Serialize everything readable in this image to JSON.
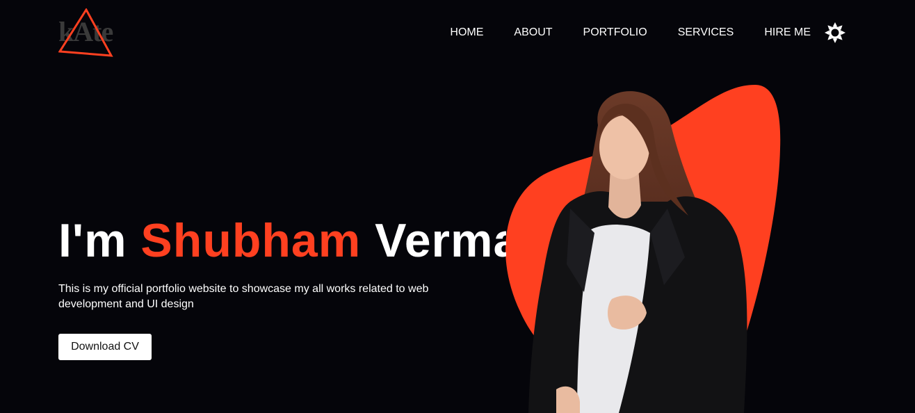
{
  "brand": {
    "logo_text": "kAte",
    "logo_color": "#3a3a3a",
    "accent": "#ff4020"
  },
  "nav": {
    "items": [
      {
        "label": "HOME"
      },
      {
        "label": "ABOUT"
      },
      {
        "label": "PORTFOLIO"
      },
      {
        "label": "SERVICES"
      },
      {
        "label": "HIRE ME"
      }
    ],
    "theme_toggle_icon": "sun-icon"
  },
  "hero": {
    "title_prefix": "I'm ",
    "title_name": "Shubham",
    "title_suffix": " Verma",
    "description": "This is my official portfolio website to showcase my all works related to web development and UI design",
    "cta_label": "Download CV",
    "image_subject": "portrait-photo",
    "background_shape_color": "#ff4020"
  },
  "colors": {
    "background": "#05050a",
    "text": "#ffffff",
    "button_bg": "#ffffff",
    "button_text": "#111111"
  }
}
